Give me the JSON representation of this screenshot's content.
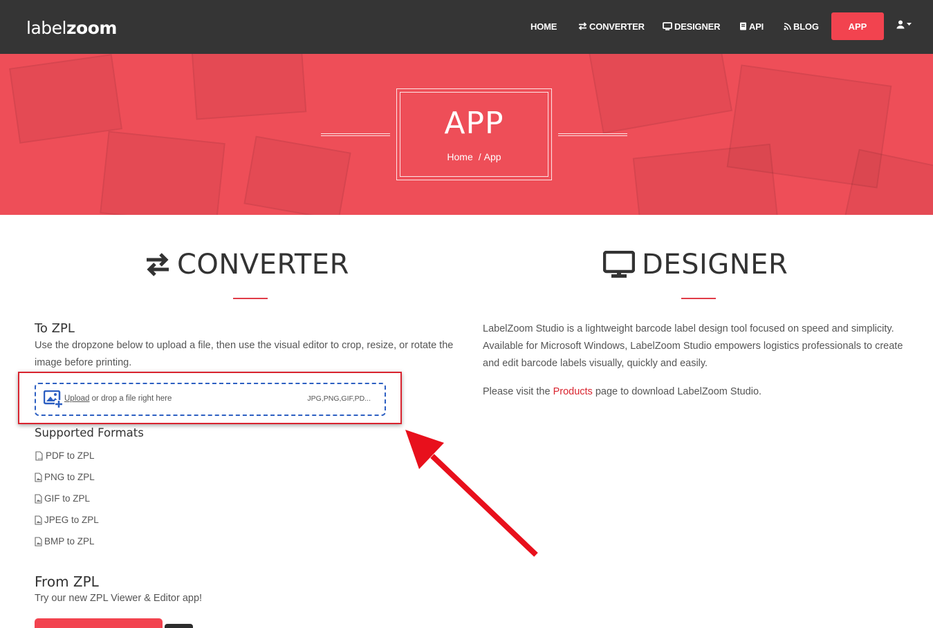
{
  "brand": {
    "part1": "label",
    "part2": "zoom"
  },
  "nav": {
    "items": [
      {
        "label": "HOME",
        "icon": "none"
      },
      {
        "label": "CONVERTER",
        "icon": "exchange-icon"
      },
      {
        "label": "DESIGNER",
        "icon": "monitor-icon"
      },
      {
        "label": "API",
        "icon": "book-icon"
      },
      {
        "label": "BLOG",
        "icon": "rss-icon"
      }
    ],
    "app_button": "APP",
    "user_icon": "user-icon"
  },
  "hero": {
    "title": "APP",
    "breadcrumb": {
      "home": "Home",
      "separator": "/",
      "current": "App"
    }
  },
  "converter": {
    "heading": "CONVERTER",
    "to_zpl": {
      "title": "To ZPL",
      "description": "Use the dropzone below to upload a file, then use the visual editor to crop, resize, or rotate the image before printing."
    },
    "dropzone": {
      "upload_link": "Upload",
      "text": "or drop a file right here",
      "types": "JPG,PNG,GIF,PD..."
    },
    "supported_formats": {
      "title": "Supported Formats",
      "items": [
        "PDF to ZPL",
        "PNG to ZPL",
        "GIF to ZPL",
        "JPEG to ZPL",
        "BMP to ZPL"
      ]
    },
    "from_zpl": {
      "title": "From ZPL",
      "description": "Try our new ZPL Viewer & Editor app!"
    }
  },
  "designer": {
    "heading": "DESIGNER",
    "description": "LabelZoom Studio is a lightweight barcode label design tool focused on speed and simplicity. Available for Microsoft Windows, LabelZoom Studio empowers logistics professionals to create and edit barcode labels visually, quickly and easily.",
    "visit_prefix": "Please visit the",
    "products_link": "Products",
    "visit_suffix": "page to download LabelZoom Studio."
  },
  "colors": {
    "accent": "#f2434f",
    "nav_bg": "#353535",
    "hero_bg": "#ee4e58",
    "annotation": "#e8101c",
    "dropzone_border": "#2c5fc2"
  }
}
